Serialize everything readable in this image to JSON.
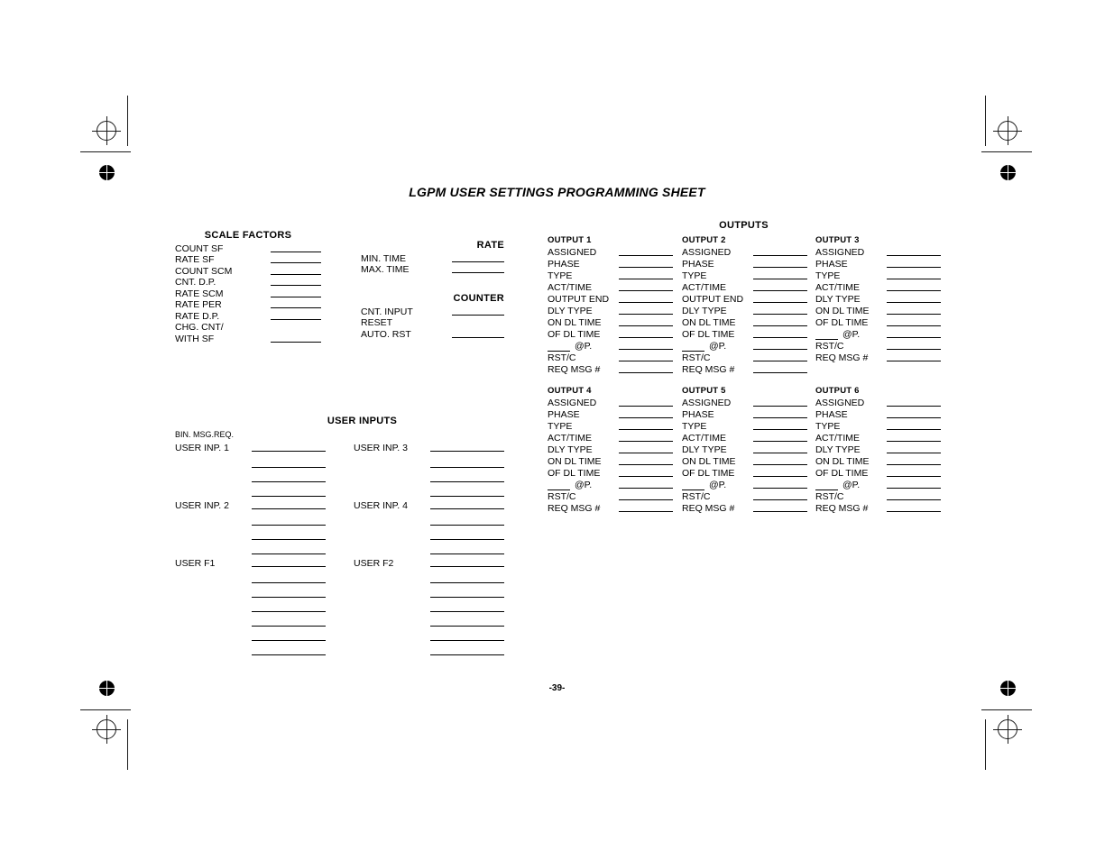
{
  "document": {
    "title": "LGPM USER SETTINGS PROGRAMMING SHEET",
    "page_number": "-39-"
  },
  "scale_factors": {
    "heading": "SCALE FACTORS",
    "rows": [
      {
        "label": "COUNT SF",
        "has_line": true
      },
      {
        "label": "RATE  SF",
        "has_line": true
      },
      {
        "label": "COUNT SCM",
        "has_line": true
      },
      {
        "label": "CNT. D.P.",
        "has_line": true
      },
      {
        "label": "RATE SCM",
        "has_line": true
      },
      {
        "label": "RATE PER",
        "has_line": true
      },
      {
        "label": "RATE D.P.",
        "has_line": true
      },
      {
        "label": "CHG. CNT/",
        "has_line": false
      },
      {
        "label": "WITH SF",
        "has_line": true
      }
    ]
  },
  "rate": {
    "heading": "RATE",
    "rows": [
      {
        "label": "MIN. TIME",
        "has_line": true
      },
      {
        "label": "MAX. TIME",
        "has_line": true
      }
    ]
  },
  "counter": {
    "heading": "COUNTER",
    "rows": [
      {
        "label": "CNT. INPUT",
        "has_line": true
      },
      {
        "label": "RESET",
        "has_line": false
      },
      {
        "label": "AUTO. RST",
        "has_line": true
      }
    ]
  },
  "outputs": {
    "heading": "OUTPUTS",
    "at_phase_label": "@P.",
    "columns": [
      {
        "title": "OUTPUT 1",
        "rows": [
          "ASSIGNED",
          "PHASE",
          "TYPE",
          "ACT/TIME",
          "OUTPUT END",
          "DLY TYPE",
          "ON DL TIME",
          "OF DL TIME"
        ],
        "tail_rows": [
          "RST/C",
          "REQ MSG #"
        ]
      },
      {
        "title": "OUTPUT 2",
        "rows": [
          "ASSIGNED",
          "PHASE",
          "TYPE",
          "ACT/TIME",
          "OUTPUT END",
          "DLY TYPE",
          "ON DL TIME",
          "OF DL TIME"
        ],
        "tail_rows": [
          "RST/C",
          "REQ MSG #"
        ]
      },
      {
        "title": "OUTPUT 3",
        "rows": [
          "ASSIGNED",
          "PHASE",
          "TYPE",
          "ACT/TIME",
          "DLY TYPE",
          "ON DL TIME",
          "OF DL TIME"
        ],
        "tail_rows": [
          "RST/C",
          "REQ MSG #"
        ]
      },
      {
        "title": "OUTPUT 4",
        "rows": [
          "ASSIGNED",
          "PHASE",
          "TYPE",
          "ACT/TIME",
          "DLY TYPE",
          "ON DL TIME",
          "OF DL TIME"
        ],
        "tail_rows": [
          "RST/C",
          "REQ MSG #"
        ]
      },
      {
        "title": "OUTPUT 5",
        "rows": [
          "ASSIGNED",
          "PHASE",
          "TYPE",
          "ACT/TIME",
          "DLY TYPE",
          "ON DL TIME",
          "OF DL TIME"
        ],
        "tail_rows": [
          "RST/C",
          "REQ MSG #"
        ]
      },
      {
        "title": "OUTPUT 6",
        "rows": [
          "ASSIGNED",
          "PHASE",
          "TYPE",
          "ACT/TIME",
          "DLY TYPE",
          "ON DL TIME",
          "OF DL TIME"
        ],
        "tail_rows": [
          "RST/C",
          "REQ MSG #"
        ]
      }
    ]
  },
  "user_inputs": {
    "heading": "USER INPUTS",
    "note": "BIN. MSG.REQ.",
    "groups": [
      {
        "label": "USER INP. 1",
        "line_count": 4
      },
      {
        "label": "USER INP. 2",
        "line_count": 4
      },
      {
        "label": "USER  F1",
        "line_count": 7
      },
      {
        "label": "USER INP. 3",
        "line_count": 4
      },
      {
        "label": "USER INP. 4",
        "line_count": 4
      },
      {
        "label": "USER  F2",
        "line_count": 7
      }
    ]
  },
  "registration_marks": {
    "crosshair_icon": "registration-crosshair",
    "bullseye_icon": "registration-bullseye",
    "trim_mark_icon": "trim-mark"
  }
}
